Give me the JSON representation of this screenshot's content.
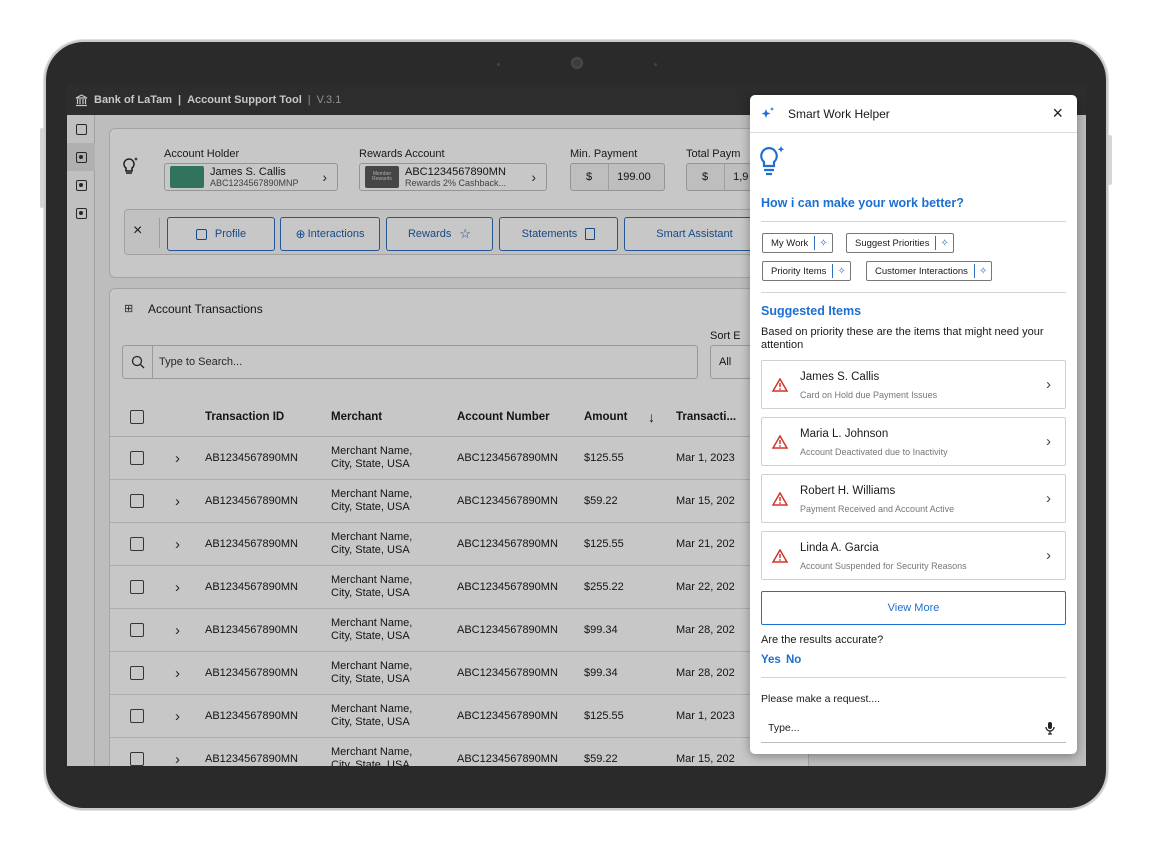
{
  "app": {
    "bank": "Bank of LaTam",
    "separator": "|",
    "name": "Account Support Tool",
    "version": "V.3.1"
  },
  "nav_icons": [
    "layout-icon",
    "settings-icon",
    "settings-icon",
    "settings-icon"
  ],
  "account": {
    "holder_label": "Account Holder",
    "holder_name": "James S. Callis",
    "holder_id": "ABC1234567890MNP",
    "rewards_label": "Rewards Account",
    "rewards_badge": "Member Rewards",
    "rewards_id": "ABC1234567890MN",
    "rewards_desc": "Rewards 2% Cashback...",
    "min_payment_label": "Min. Payment",
    "min_payment_currency": "$",
    "min_payment_value": "199.00",
    "total_payment_label": "Total Paym",
    "total_payment_currency": "$",
    "total_payment_value": "1,9"
  },
  "toolbar": {
    "close": "×",
    "profile": "Profile",
    "interactions": "Interactions",
    "rewards": "Rewards",
    "statements": "Statements",
    "smart_assistant": "Smart Assistant"
  },
  "transactions": {
    "title": "Account Transactions",
    "sort_label": "Sort E",
    "sort_value": "All",
    "search_placeholder": "Type to Search...",
    "columns": [
      "Transaction ID",
      "Merchant",
      "Account Number",
      "Amount",
      "Transacti..."
    ],
    "sort_arrow": "↓",
    "rows": [
      {
        "id": "AB1234567890MN",
        "merchant1": "Merchant Name,",
        "merchant2": "City, State, USA",
        "account": "ABC1234567890MN",
        "amount": "$125.55",
        "date": "Mar 1, 2023"
      },
      {
        "id": "AB1234567890MN",
        "merchant1": "Merchant Name,",
        "merchant2": "City, State, USA",
        "account": "ABC1234567890MN",
        "amount": "$59.22",
        "date": "Mar 15, 202"
      },
      {
        "id": "AB1234567890MN",
        "merchant1": "Merchant Name,",
        "merchant2": "City, State, USA",
        "account": "ABC1234567890MN",
        "amount": "$125.55",
        "date": "Mar 21, 202"
      },
      {
        "id": "AB1234567890MN",
        "merchant1": "Merchant Name,",
        "merchant2": "City, State, USA",
        "account": "ABC1234567890MN",
        "amount": "$255.22",
        "date": "Mar 22, 202"
      },
      {
        "id": "AB1234567890MN",
        "merchant1": "Merchant Name,",
        "merchant2": "City, State, USA",
        "account": "ABC1234567890MN",
        "amount": "$99.34",
        "date": "Mar 28, 202"
      },
      {
        "id": "AB1234567890MN",
        "merchant1": "Merchant Name,",
        "merchant2": "City, State, USA",
        "account": "ABC1234567890MN",
        "amount": "$99.34",
        "date": "Mar 28, 202"
      },
      {
        "id": "AB1234567890MN",
        "merchant1": "Merchant Name,",
        "merchant2": "City, State, USA",
        "account": "ABC1234567890MN",
        "amount": "$125.55",
        "date": "Mar 1, 2023"
      },
      {
        "id": "AB1234567890MN",
        "merchant1": "Merchant Name,",
        "merchant2": "City, State, USA",
        "account": "ABC1234567890MN",
        "amount": "$59.22",
        "date": "Mar 15, 202"
      }
    ]
  },
  "helper": {
    "title": "Smart Work Helper",
    "close": "×",
    "question": "How i can make your work better?",
    "chips": [
      "My Work",
      "Suggest Priorities",
      "Priority Items",
      "Customer Interactions"
    ],
    "suggested_title": "Suggested Items",
    "suggested_desc": "Based on priority these are the items that might need your attention",
    "items": [
      {
        "name": "James S. Callis",
        "desc": "Card on Hold due Payment Issues"
      },
      {
        "name": "Maria L. Johnson",
        "desc": "Account Deactivated due to Inactivity"
      },
      {
        "name": "Robert H. Williams",
        "desc": "Payment Received and Account Active"
      },
      {
        "name": "Linda A. Garcia",
        "desc": "Account Suspended for Security Reasons"
      }
    ],
    "view_more": "View More",
    "accuracy_q": "Are the results accurate?",
    "yes": "Yes",
    "no": "No",
    "request_label": "Please make a request....",
    "request_placeholder": "Type..."
  },
  "colors": {
    "accent": "#1d6fd1",
    "warning": "#d0342c",
    "topbar": "#3a3a3a"
  }
}
